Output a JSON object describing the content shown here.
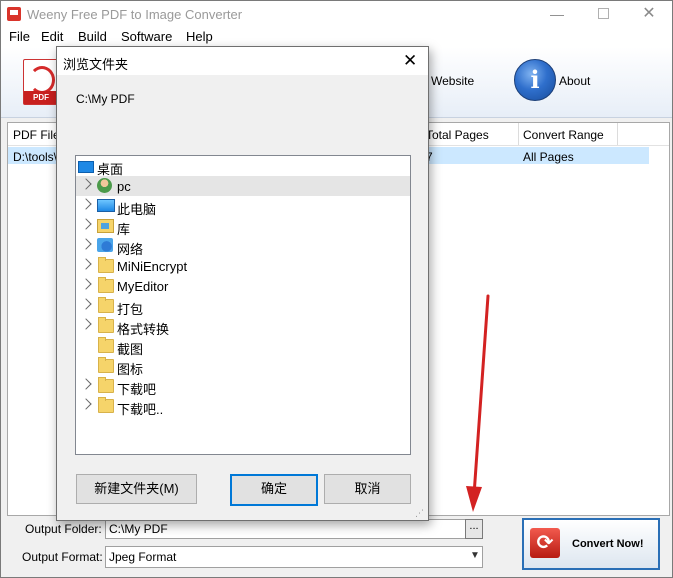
{
  "window": {
    "title": "Weeny Free PDF to Image Converter",
    "minimize": "—",
    "close": "✕"
  },
  "menu": [
    "File",
    "Edit",
    "Build",
    "Software",
    "Help"
  ],
  "toolbar": {
    "pdf_icon_text": "PDF",
    "website_label": "Website",
    "about_label": "About",
    "about_icon_glyph": "i"
  },
  "file_list": {
    "columns": [
      "PDF Files",
      "Total Pages",
      "Convert Range"
    ],
    "rows": [
      {
        "file": "D:\\tools\\",
        "pages": "7",
        "range": "All Pages"
      }
    ]
  },
  "output": {
    "folder_label": "Output Folder:",
    "folder_value": "C:\\My PDF",
    "browse_label": "...",
    "format_label": "Output Format:",
    "format_value": "Jpeg Format"
  },
  "convert": {
    "label": "Convert Now!"
  },
  "dialog": {
    "title": "浏览文件夹",
    "selected_path": "C:\\My PDF",
    "tree": [
      {
        "label": "桌面",
        "expandable": false,
        "icon": "desktop-icon"
      },
      {
        "label": "pc",
        "expandable": true,
        "icon": "user-icon"
      },
      {
        "label": "此电脑",
        "expandable": true,
        "icon": "computer-icon"
      },
      {
        "label": "库",
        "expandable": true,
        "icon": "library-icon"
      },
      {
        "label": "网络",
        "expandable": true,
        "icon": "network-icon"
      },
      {
        "label": "MiNiEncrypt",
        "expandable": true,
        "icon": "folder-icon"
      },
      {
        "label": "MyEditor",
        "expandable": true,
        "icon": "folder-icon"
      },
      {
        "label": "打包",
        "expandable": true,
        "icon": "folder-icon"
      },
      {
        "label": "格式转换",
        "expandable": true,
        "icon": "folder-icon"
      },
      {
        "label": "截图",
        "expandable": false,
        "icon": "folder-icon"
      },
      {
        "label": "图标",
        "expandable": false,
        "icon": "folder-icon"
      },
      {
        "label": "下载吧",
        "expandable": true,
        "icon": "folder-icon"
      },
      {
        "label": "下载吧..",
        "expandable": true,
        "icon": "folder-icon"
      }
    ],
    "new_folder_label": "新建文件夹(M)",
    "ok_label": "确定",
    "cancel_label": "取消"
  },
  "colors": {
    "selection": "#cce8ff",
    "accent": "#0078d7",
    "annotation_arrow": "#d32222"
  }
}
